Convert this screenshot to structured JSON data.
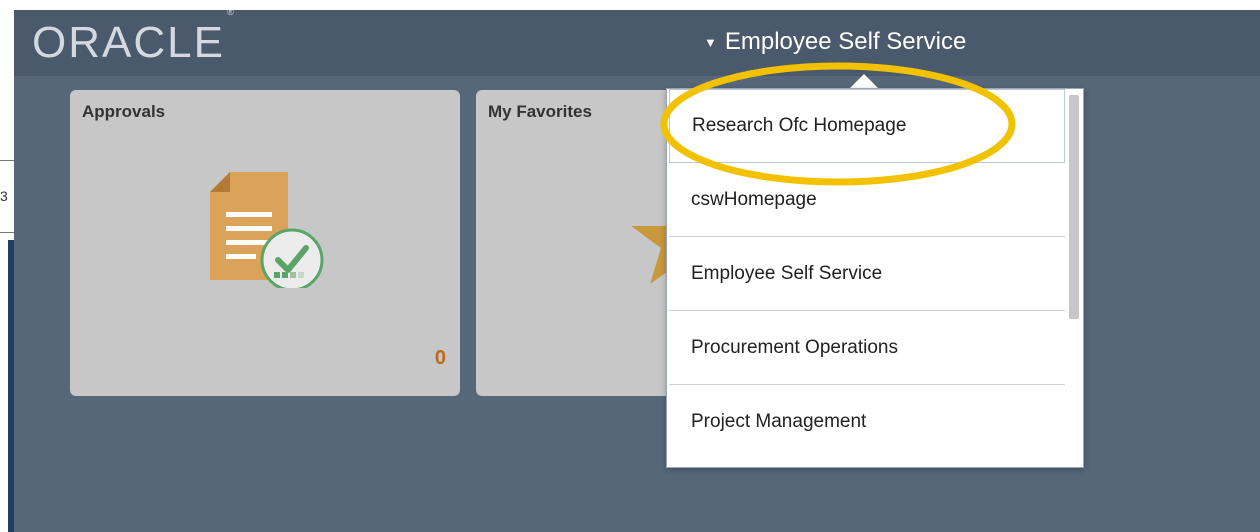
{
  "header": {
    "logo_text": "ORACLE",
    "logo_mark": "®",
    "homepage_selector_label": "Employee Self Service"
  },
  "tiles": [
    {
      "title": "Approvals",
      "count": "0"
    },
    {
      "title": "My Favorites"
    }
  ],
  "homepage_menu": {
    "items": [
      {
        "label": "Research Ofc Homepage",
        "selected": true
      },
      {
        "label": "cswHomepage"
      },
      {
        "label": "Employee Self Service"
      },
      {
        "label": "Procurement Operations"
      },
      {
        "label": "Project Management"
      }
    ]
  },
  "left_edge": {
    "char": "3"
  },
  "colors": {
    "banner_bg": "#56677a",
    "tile_bg": "#c7c7c7",
    "approvals_icon": "#dba25a",
    "check_circle": "#5aa468",
    "favorites_star": "#c9983c",
    "count_color": "#b86d1f",
    "annotation_ellipse": "#f2c200"
  },
  "icons": {
    "approvals": "document-check-icon",
    "favorites": "star-icon",
    "selector": "triangle-down-icon"
  }
}
